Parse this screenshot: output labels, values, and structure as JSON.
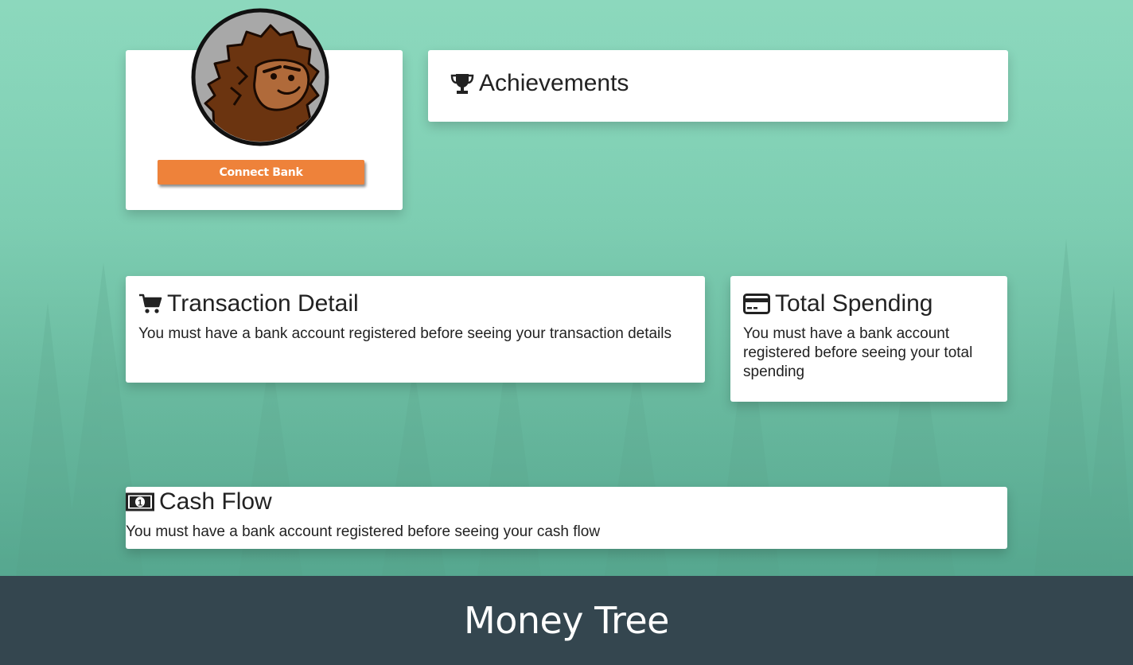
{
  "profile": {
    "avatar_alt": "sasquatch avatar",
    "connect_button_label": "Connect Bank"
  },
  "achievements": {
    "title": "Achievements",
    "icon": "trophy-icon"
  },
  "transaction_detail": {
    "title": "Transaction Detail",
    "icon": "cart-icon",
    "message": "You must have a bank account registered before seeing your transaction details"
  },
  "total_spending": {
    "title": "Total Spending",
    "icon": "credit-card-icon",
    "message": "You must have a bank account registered before seeing your total spending"
  },
  "cash_flow": {
    "title": "Cash Flow",
    "icon": "money-bill-icon",
    "message": "You must have a bank account registered before seeing your cash flow"
  },
  "footer": {
    "title": "Money Tree"
  },
  "colors": {
    "accent": "#ee823a",
    "footer_bg": "#34464f",
    "background": "#7fd0b4"
  }
}
